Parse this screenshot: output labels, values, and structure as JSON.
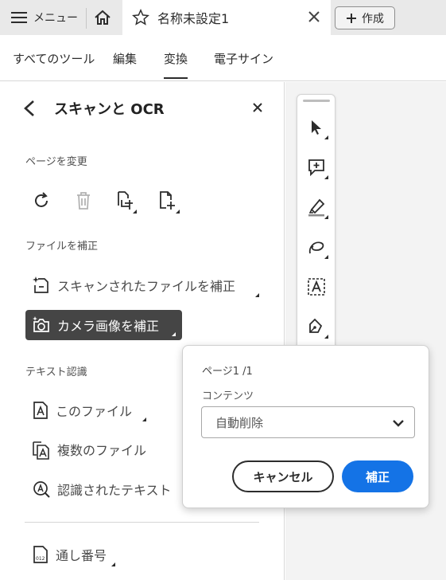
{
  "topbar": {
    "menu_label": "メニュー",
    "doc_tab_title": "名称未設定1",
    "new_label": "作成"
  },
  "menubar": {
    "tabs": [
      {
        "label": "すべてのツール"
      },
      {
        "label": "編集"
      },
      {
        "label": "変換",
        "active": true
      },
      {
        "label": "電子サイン"
      }
    ]
  },
  "panel": {
    "title": "スキャンと OCR",
    "sections": {
      "page_change": "ページを変更",
      "file_fix": "ファイルを補正",
      "text_recognition": "テキスト認識"
    },
    "items": {
      "fix_scanned": "スキャンされたファイルを補正",
      "fix_camera": "カメラ画像を補正",
      "this_file": "このファイル",
      "multiple_files": "複数のファイル",
      "recognized_text": "認識されたテキスト",
      "bates": "通し番号"
    }
  },
  "popover": {
    "page_indicator": "ページ1 /1",
    "content_label": "コンテンツ",
    "content_value": "自動削除",
    "cancel_label": "キャンセル",
    "apply_label": "補正"
  },
  "colors": {
    "accent": "#1473e6",
    "selected_item_bg": "#454545",
    "topbar_bg": "#e9e9e9"
  }
}
